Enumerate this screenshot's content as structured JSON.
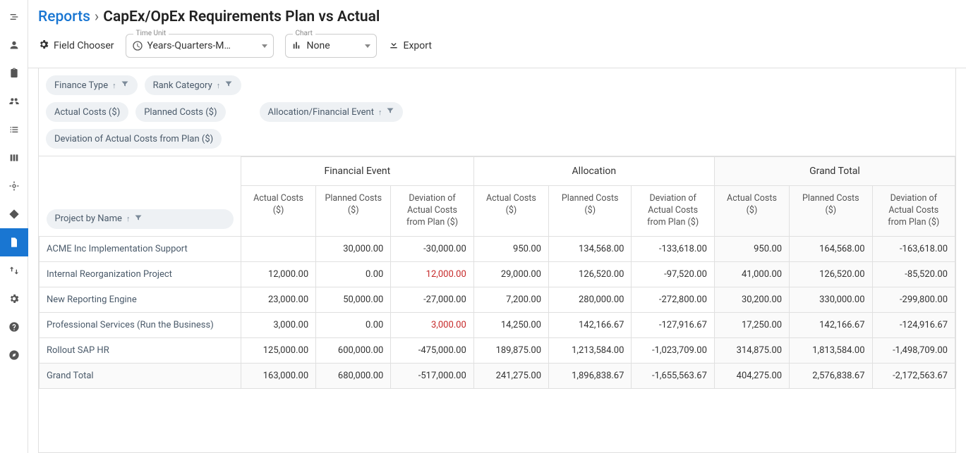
{
  "breadcrumb": {
    "root": "Reports",
    "sep": "›",
    "title": "CapEx/OpEx Requirements Plan vs Actual"
  },
  "toolbar": {
    "field_chooser": "Field Chooser",
    "time_unit_label": "Time Unit",
    "time_unit_value": "Years-Quarters-M…",
    "chart_label": "Chart",
    "chart_value": "None",
    "export": "Export"
  },
  "chips": {
    "row1": [
      {
        "id": "finance-type",
        "label": "Finance Type",
        "sort": true,
        "filter": true
      },
      {
        "id": "rank-category",
        "label": "Rank Category",
        "sort": true,
        "filter": true
      }
    ],
    "row2a": [
      {
        "id": "actual-costs",
        "label": "Actual Costs ($)"
      },
      {
        "id": "planned-costs",
        "label": "Planned Costs ($)"
      }
    ],
    "row2b": [
      {
        "id": "alloc-fin-event",
        "label": "Allocation/Financial Event",
        "sort": true,
        "filter": true
      }
    ],
    "row3": [
      {
        "id": "deviation",
        "label": "Deviation of Actual Costs from Plan ($)"
      }
    ],
    "row_header": {
      "id": "project-by-name",
      "label": "Project by Name",
      "sort": true,
      "filter": true
    }
  },
  "grid": {
    "col_groups": [
      "Financial Event",
      "Allocation",
      "Grand Total"
    ],
    "sub_cols": [
      "Actual Costs ($)",
      "Planned Costs ($)",
      "Deviation of Actual Costs from Plan ($)"
    ],
    "rows": [
      {
        "name": "ACME Inc Implementation Support",
        "cells": [
          "",
          "30,000.00",
          "-30,000.00",
          "950.00",
          "134,568.00",
          "-133,618.00",
          "950.00",
          "164,568.00",
          "-163,618.00"
        ],
        "neg": [
          false,
          false,
          false,
          false,
          false,
          false,
          false,
          false,
          false
        ]
      },
      {
        "name": "Internal Reorganization Project",
        "cells": [
          "12,000.00",
          "0.00",
          "12,000.00",
          "29,000.00",
          "126,520.00",
          "-97,520.00",
          "41,000.00",
          "126,520.00",
          "-85,520.00"
        ],
        "neg": [
          false,
          false,
          true,
          false,
          false,
          false,
          false,
          false,
          false
        ]
      },
      {
        "name": "New Reporting Engine",
        "cells": [
          "23,000.00",
          "50,000.00",
          "-27,000.00",
          "7,200.00",
          "280,000.00",
          "-272,800.00",
          "30,200.00",
          "330,000.00",
          "-299,800.00"
        ],
        "neg": [
          false,
          false,
          false,
          false,
          false,
          false,
          false,
          false,
          false
        ]
      },
      {
        "name": "Professional Services (Run the Business)",
        "cells": [
          "3,000.00",
          "0.00",
          "3,000.00",
          "14,250.00",
          "142,166.67",
          "-127,916.67",
          "17,250.00",
          "142,166.67",
          "-124,916.67"
        ],
        "neg": [
          false,
          false,
          true,
          false,
          false,
          false,
          false,
          false,
          false
        ]
      },
      {
        "name": "Rollout SAP HR",
        "cells": [
          "125,000.00",
          "600,000.00",
          "-475,000.00",
          "189,875.00",
          "1,213,584.00",
          "-1,023,709.00",
          "314,875.00",
          "1,813,584.00",
          "-1,498,709.00"
        ],
        "neg": [
          false,
          false,
          false,
          false,
          false,
          false,
          false,
          false,
          false
        ]
      }
    ],
    "grand_total": {
      "name": "Grand Total",
      "cells": [
        "163,000.00",
        "680,000.00",
        "-517,000.00",
        "241,275.00",
        "1,896,838.67",
        "-1,655,563.67",
        "404,275.00",
        "2,576,838.67",
        "-2,172,563.67"
      ]
    }
  },
  "chart_data": {
    "type": "table",
    "row_dimension": "Project by Name",
    "col_groups": [
      "Financial Event",
      "Allocation",
      "Grand Total"
    ],
    "measures": [
      "Actual Costs ($)",
      "Planned Costs ($)",
      "Deviation of Actual Costs from Plan ($)"
    ],
    "rows": {
      "ACME Inc Implementation Support": [
        null,
        30000.0,
        -30000.0,
        950.0,
        134568.0,
        -133618.0,
        950.0,
        164568.0,
        -163618.0
      ],
      "Internal Reorganization Project": [
        12000.0,
        0.0,
        12000.0,
        29000.0,
        126520.0,
        -97520.0,
        41000.0,
        126520.0,
        -85520.0
      ],
      "New Reporting Engine": [
        23000.0,
        50000.0,
        -27000.0,
        7200.0,
        280000.0,
        -272800.0,
        30200.0,
        330000.0,
        -299800.0
      ],
      "Professional Services (Run the Business)": [
        3000.0,
        0.0,
        3000.0,
        14250.0,
        142166.67,
        -127916.67,
        17250.0,
        142166.67,
        -124916.67
      ],
      "Rollout SAP HR": [
        125000.0,
        600000.0,
        -475000.0,
        189875.0,
        1213584.0,
        -1023709.0,
        314875.0,
        1813584.0,
        -1498709.0
      ]
    },
    "grand_total": [
      163000.0,
      680000.0,
      -517000.0,
      241275.0,
      1896838.67,
      -1655563.67,
      404275.0,
      2576838.67,
      -2172563.67
    ]
  }
}
